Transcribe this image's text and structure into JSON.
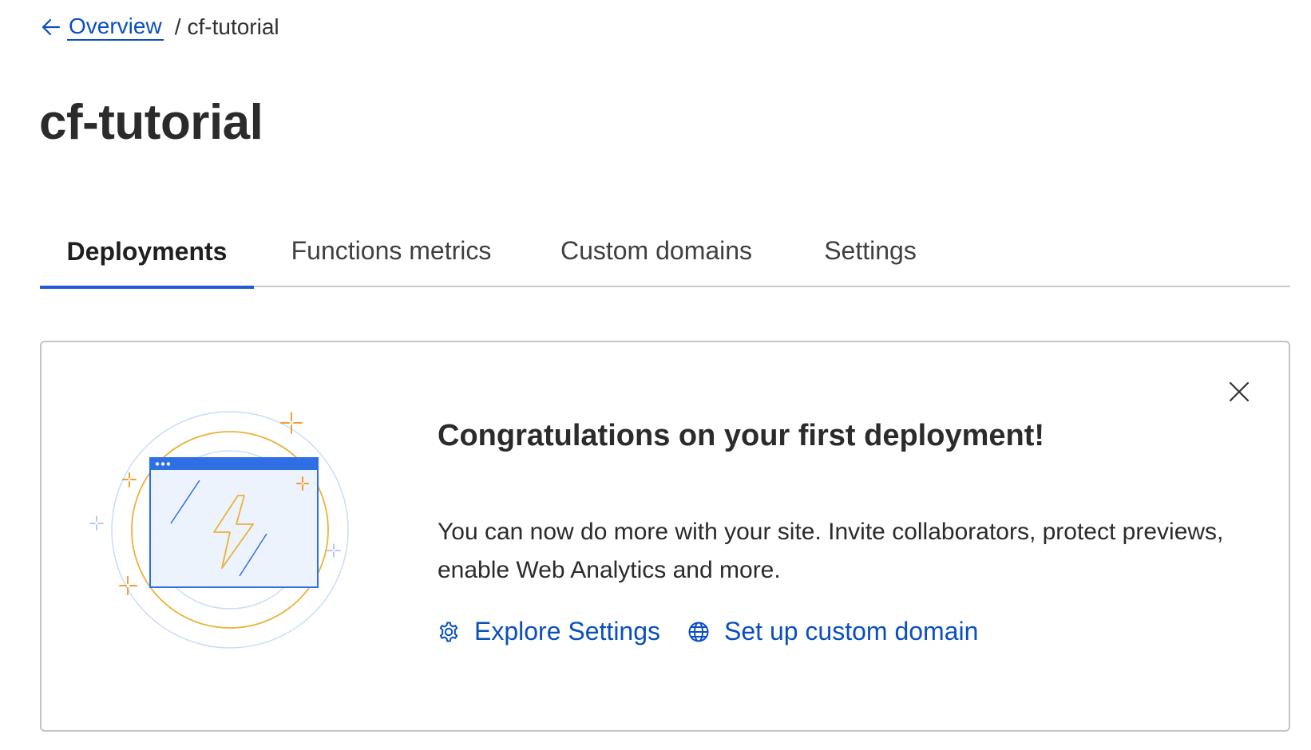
{
  "breadcrumb": {
    "back_label": "Overview",
    "separator": "/",
    "current": "cf-tutorial"
  },
  "page": {
    "title": "cf-tutorial"
  },
  "tabs": [
    {
      "label": "Deployments",
      "active": true
    },
    {
      "label": "Functions metrics",
      "active": false
    },
    {
      "label": "Custom domains",
      "active": false
    },
    {
      "label": "Settings",
      "active": false
    }
  ],
  "banner": {
    "title": "Congratulations on your first deployment!",
    "body": "You can now do more with your site. Invite collaborators, protect previews, enable Web Analytics and more.",
    "actions": {
      "explore_settings": {
        "label": "Explore Settings",
        "icon": "gear-icon"
      },
      "custom_domain": {
        "label": "Set up custom domain",
        "icon": "globe-icon"
      }
    },
    "close_icon": "close-icon"
  },
  "colors": {
    "link": "#0b4fbf",
    "tab_active": "#2458d8",
    "illustration_blue": "#2f6fe4",
    "illustration_orange": "#f0a030"
  }
}
